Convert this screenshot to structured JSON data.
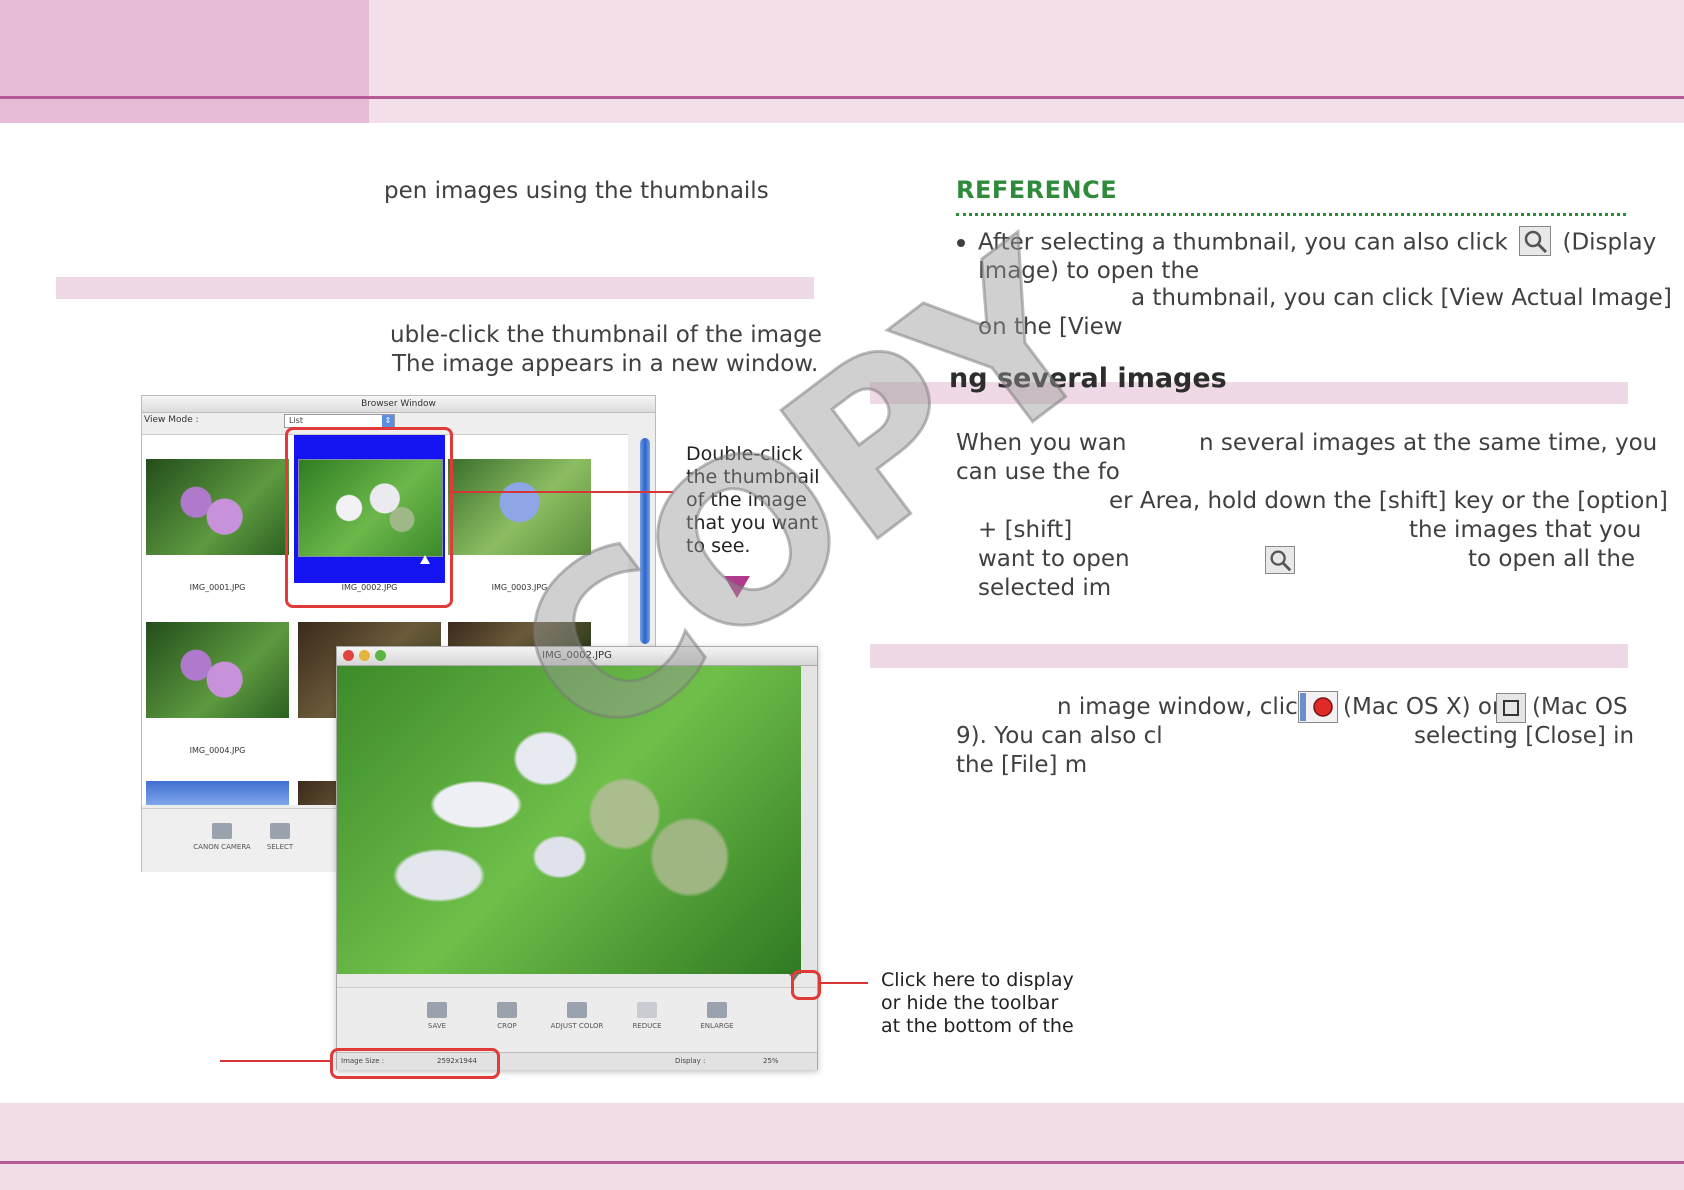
{
  "left": {
    "intro": "pen images using the thumbnails",
    "step_line1": "uble-click the thumbnail of the image",
    "step_line2": "The image appears in a new window."
  },
  "browser_window": {
    "title": "Browser Window",
    "view_mode_label": "View Mode :",
    "view_mode_value": "List",
    "thumbnails": [
      {
        "caption": "IMG_0001.JPG"
      },
      {
        "caption": "IMG_0002.JPG"
      },
      {
        "caption": "IMG_0003.JPG"
      },
      {
        "caption": "IMG_0004.JPG"
      }
    ],
    "toolbar": [
      {
        "label": "CANON CAMERA",
        "icon": "camera-icon"
      },
      {
        "label": "SELECT",
        "icon": "select-icon"
      }
    ]
  },
  "image_window": {
    "title": "IMG_0002.JPG",
    "toolbar": [
      {
        "label": "SAVE",
        "icon": "save-icon"
      },
      {
        "label": "CROP",
        "icon": "crop-icon"
      },
      {
        "label": "ADJUST COLOR",
        "icon": "adjust-color-icon"
      },
      {
        "label": "REDUCE",
        "icon": "reduce-icon"
      },
      {
        "label": "ENLARGE",
        "icon": "enlarge-icon"
      }
    ],
    "status_size_label": "Image Size :",
    "status_size_value": "2592x1944",
    "status_display_label": "Display :",
    "status_display_value": "25%"
  },
  "callouts": {
    "double_click": [
      "Double-click",
      "the thumbnail",
      "of the image",
      "that you want",
      "to see."
    ],
    "toolbar_toggle": [
      "Click here to display",
      "or hide the toolbar",
      "at the bottom of the"
    ]
  },
  "reference": {
    "title": "REFERENCE",
    "bullet_line1_a": "After selecting a thumbnail, you can also click",
    "bullet_line1_b": "(Display",
    "bullet_line2": "Image) to open the",
    "bullet_line3": "a thumbnail, you can click [View Actual Image]",
    "bullet_line4": "on the [View"
  },
  "section_several": {
    "title": "ng several images",
    "line1_a": "When you wan",
    "line1_b": "n several images at the same time, you",
    "line2": "can use the fo",
    "line3": "er Area, hold down the [shift] key or the [option]",
    "line4_a": "+ [shift]",
    "line4_b": "the images that you",
    "line5_a": "want to open",
    "line5_b": "to open all the",
    "line6": "selected im"
  },
  "section_close": {
    "line1_a": "n image window, click",
    "line1_b": "(Mac OS X) or",
    "line1_c": "(Mac OS",
    "line2_a": "9). You can also cl",
    "line2_b": "selecting [Close] in",
    "line3": "the [File] m"
  },
  "watermark": "COPY",
  "colors": {
    "header_dark": "#e6bcd6",
    "header_light": "#f3dfea",
    "rule": "#b45a96",
    "reference_green": "#2f8a3c",
    "callout_red": "#e03a3a",
    "selected_blue": "#1414f0"
  }
}
